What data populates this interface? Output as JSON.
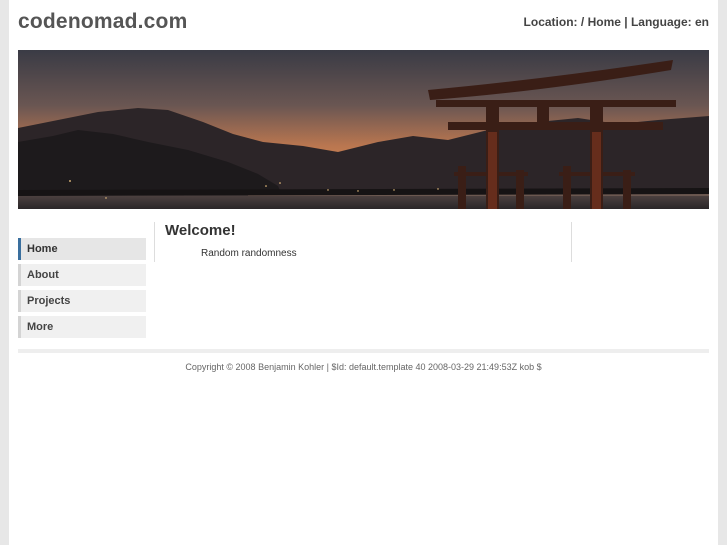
{
  "header": {
    "site_title": "codenomad.com",
    "location_label": "Location:",
    "location_separator": "/",
    "location_home": "Home",
    "divider": "|",
    "language_label": "Language:",
    "language_value": "en"
  },
  "nav": {
    "items": [
      {
        "label": "Home",
        "active": true
      },
      {
        "label": "About",
        "active": false
      },
      {
        "label": "Projects",
        "active": false
      },
      {
        "label": "More",
        "active": false
      }
    ]
  },
  "content": {
    "heading": "Welcome!",
    "text": "Random randomness"
  },
  "footer": {
    "text": "Copyright © 2008 Benjamin Kohler | $Id: default.template 40 2008-03-29 21:49:53Z kob $"
  },
  "colors": {
    "page_background": "#ffffff",
    "outer_background": "#e7e7e7",
    "nav_active_accent": "#3a6f9e",
    "nav_accent": "#d4d4d4",
    "torii": "#8a3a22"
  }
}
